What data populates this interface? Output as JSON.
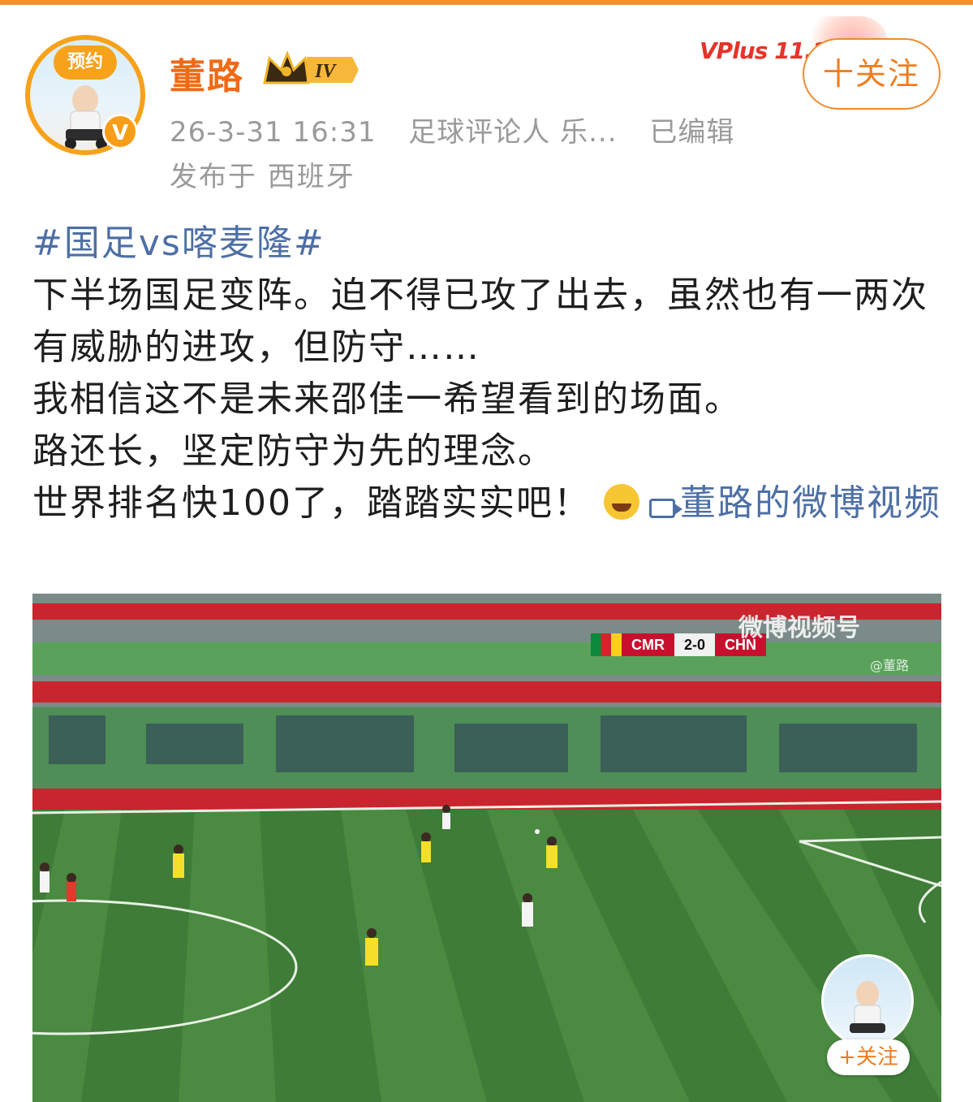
{
  "header": {
    "avatar_badge": "预约",
    "verified_badge": "V",
    "username": "董路",
    "level_badge": "IV",
    "vplus_label": "VPlus 11.11",
    "follow_label": "十关注",
    "timestamp": "26-3-31 16:31",
    "role": "足球评论人 乐...",
    "edited": "已编辑",
    "location": "发布于 西班牙"
  },
  "post": {
    "hashtag": "#国足vs喀麦隆#",
    "line1": "下半场国足变阵。迫不得已攻了出去，虽然也有一两次有威胁的进攻，但防守……",
    "line2": "我相信这不是未来邵佳一希望看到的场面。",
    "line3": "路还长，坚定防守为先的理念。",
    "line4": "世界排名快100了，踏踏实实吧！",
    "emoji": "laugh-cry-emoji",
    "video_link": "董路的微博视频"
  },
  "video": {
    "score_team1": "CMR",
    "score": "2-0",
    "score_team2": "CHN",
    "watermark": "微博视频号",
    "watermark_user": "@董路",
    "pip_follow": "+关注"
  },
  "colors": {
    "accent": "#f06a16",
    "link": "#4d6fa5",
    "meta": "#9a9a9a"
  }
}
